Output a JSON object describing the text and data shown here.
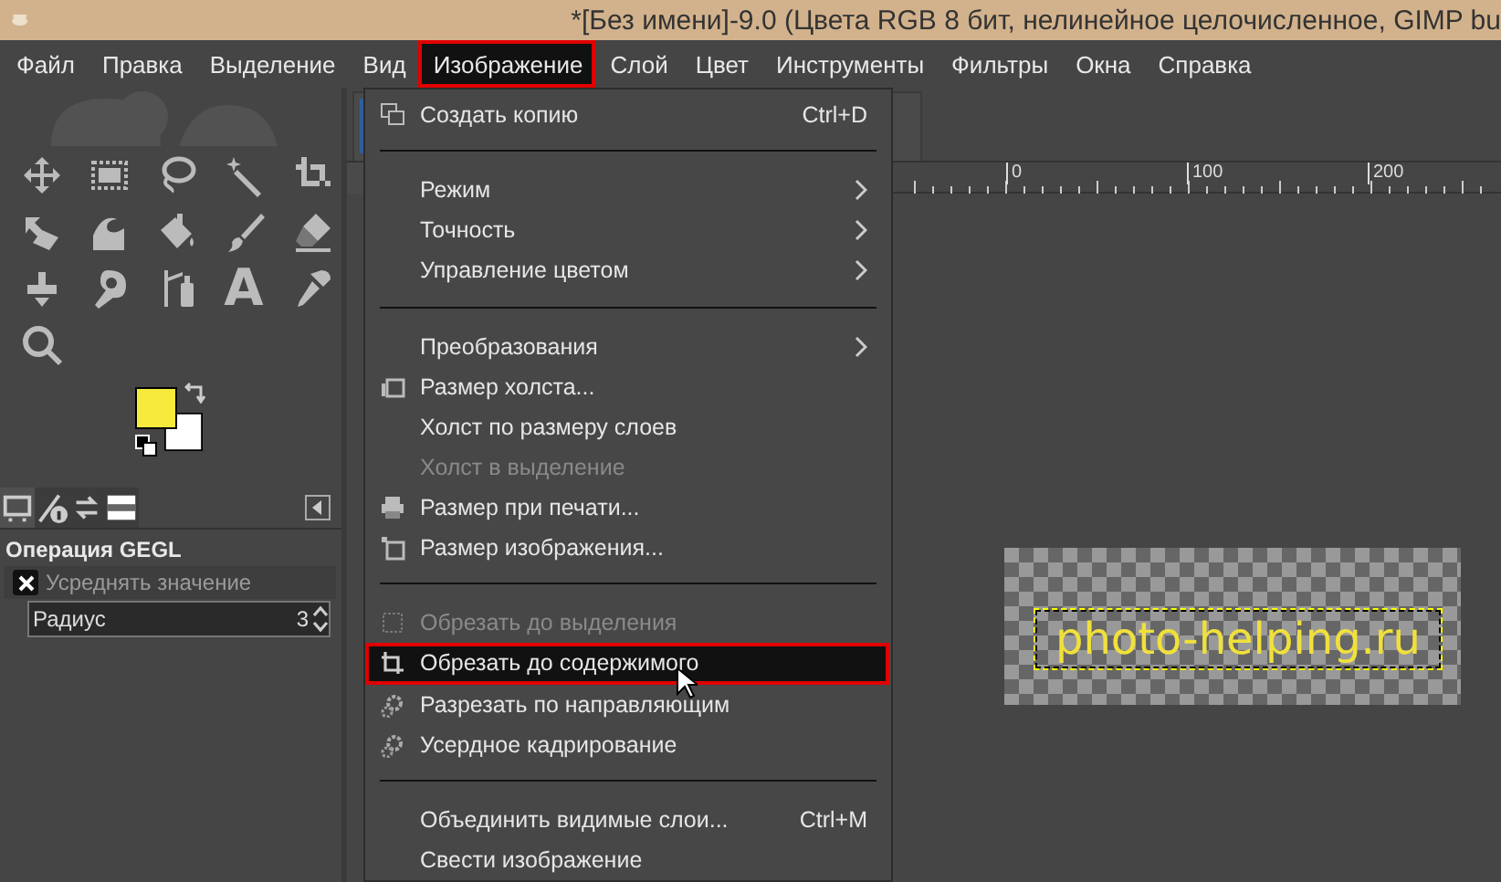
{
  "window": {
    "title": "*[Без имени]-9.0 (Цвета RGB 8 бит, нелинейное целочисленное, GIMP bu"
  },
  "menubar": [
    {
      "label": "Файл",
      "selected": false
    },
    {
      "label": "Правка",
      "selected": false
    },
    {
      "label": "Выделение",
      "selected": false
    },
    {
      "label": "Вид",
      "selected": false
    },
    {
      "label": "Изображение",
      "selected": true
    },
    {
      "label": "Слой",
      "selected": false
    },
    {
      "label": "Цвет",
      "selected": false
    },
    {
      "label": "Инструменты",
      "selected": false
    },
    {
      "label": "Фильтры",
      "selected": false
    },
    {
      "label": "Окна",
      "selected": false
    },
    {
      "label": "Справка",
      "selected": false
    }
  ],
  "toolbox": {
    "text_tool_label": "A"
  },
  "tool_options": {
    "tabs": [
      {
        "kind": "device",
        "selected": true
      },
      {
        "kind": "info",
        "selected": false
      },
      {
        "kind": "undo",
        "selected": false
      },
      {
        "kind": "image",
        "selected": false
      }
    ],
    "title": "Операция GEGL",
    "options": [
      {
        "kind": "checkbox",
        "label": "Усреднять значение",
        "checked": true
      },
      {
        "kind": "spin",
        "label": "Радиус",
        "value": "3"
      }
    ]
  },
  "image_window": {
    "ruler_ticks": [
      "0",
      "100",
      "200"
    ],
    "canvas_text": "photo-helping.ru"
  },
  "menu": {
    "items": [
      {
        "kind": "item",
        "label": "Создать копию",
        "shortcut": "Ctrl+D",
        "disabled": false,
        "selected": false
      },
      {
        "kind": "separator"
      },
      {
        "kind": "submenu",
        "label": "Режим",
        "disabled": false,
        "selected": false
      },
      {
        "kind": "submenu",
        "label": "Точность",
        "disabled": false,
        "selected": false
      },
      {
        "kind": "submenu",
        "label": "Управление цветом",
        "disabled": false,
        "selected": false
      },
      {
        "kind": "separator"
      },
      {
        "kind": "submenu",
        "label": "Преобразования",
        "disabled": false,
        "selected": false
      },
      {
        "kind": "item",
        "label": "Размер холста...",
        "disabled": false,
        "selected": false
      },
      {
        "kind": "item",
        "label": "Холст по размеру слоев",
        "disabled": false,
        "selected": false
      },
      {
        "kind": "item",
        "label": "Холст в выделение",
        "disabled": true,
        "selected": false
      },
      {
        "kind": "item",
        "label": "Размер при печати...",
        "disabled": false,
        "selected": false
      },
      {
        "kind": "item",
        "label": "Размер изображения...",
        "disabled": false,
        "selected": false
      },
      {
        "kind": "separator"
      },
      {
        "kind": "item",
        "label": "Обрезать до выделения",
        "disabled": true,
        "selected": false
      },
      {
        "kind": "item",
        "label": "Обрезать до содержимого",
        "disabled": false,
        "selected": true
      },
      {
        "kind": "item",
        "label": "Разрезать по направляющим",
        "disabled": false,
        "selected": false
      },
      {
        "kind": "item",
        "label": "Усердное кадрирование",
        "disabled": false,
        "selected": false
      },
      {
        "kind": "separator"
      },
      {
        "kind": "item",
        "label": "Объединить видимые слои...",
        "shortcut": "Ctrl+M",
        "disabled": false,
        "selected": false
      },
      {
        "kind": "item",
        "label": "Свести изображение",
        "disabled": false,
        "selected": false
      }
    ]
  }
}
